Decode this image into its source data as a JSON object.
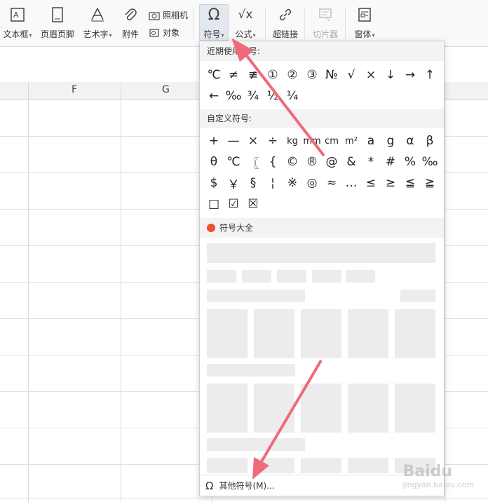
{
  "ribbon": {
    "textbox": "文本框",
    "header_footer": "页眉页脚",
    "art_text": "艺术字",
    "attachment": "附件",
    "camera": "照相机",
    "object": "对象",
    "symbol": "符号",
    "formula": "公式",
    "hyperlink": "超链接",
    "slicer": "切片器",
    "window": "窗体"
  },
  "sheet": {
    "col_f": "F",
    "col_g": "G"
  },
  "panel": {
    "recent_title": "近期使用符号:",
    "recent_row1": [
      "℃",
      "≠",
      "≢",
      "①",
      "②",
      "③",
      "№",
      "√",
      "×",
      "↓",
      "→",
      "↑"
    ],
    "recent_row2": [
      "←",
      "‰",
      "¾",
      "½",
      "¼"
    ],
    "custom_title": "自定义符号:",
    "custom_row1": [
      "+",
      "—",
      "×",
      "÷",
      "kg",
      "mm",
      "cm",
      "m²",
      "a",
      "g",
      "α",
      "β"
    ],
    "custom_row2": [
      "θ",
      "℃",
      "〖",
      "{",
      "©",
      "®",
      "@",
      "&",
      "*",
      "#",
      "%",
      "‰"
    ],
    "custom_row3": [
      "$",
      "￥",
      "§",
      "¦",
      "※",
      "◎",
      "≈",
      "…",
      "≤",
      "≥",
      "≦",
      "≧"
    ],
    "custom_row4": [
      "□",
      "☑",
      "☒"
    ],
    "all_title": "符号大全",
    "more_symbols": "其他符号(M)..."
  },
  "watermark": {
    "brand": "Baidu",
    "site": "jingyan.baidu.com"
  },
  "colors": {
    "arrow": "#f06a7a",
    "accent_fire": "#e8522f"
  }
}
